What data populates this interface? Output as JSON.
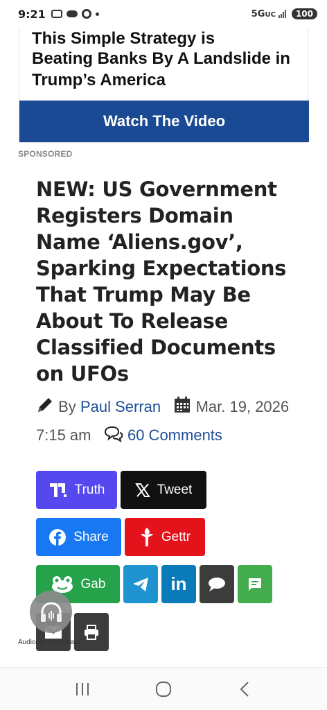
{
  "status_bar": {
    "time": "9:21",
    "network": "5G",
    "network_sub": "UC",
    "battery": "100"
  },
  "ad": {
    "headline_partial": "This Simple Strategy is",
    "headline_rest": "Beating Banks By A Landslide in Trump’s America",
    "button_label": "Watch The Video",
    "sponsored_label": "SPONSORED",
    "button_color": "#1a4a93"
  },
  "article": {
    "title": "NEW: US Government Registers Domain Name ‘Aliens.gov’, Sparking Expectations That Trump May Be About To Release Classified Documents on UFOs",
    "by_label": "By",
    "author": "Paul Serran",
    "date": "Mar. 19, 2026 7:15 am",
    "comments": "60 Comments",
    "link_color": "#1f4f9a"
  },
  "share": {
    "truth": "Truth",
    "tweet": "Tweet",
    "share": "Share",
    "gettr": "Gettr",
    "gab": "Gab",
    "linkedin_glyph": "in",
    "icons": [
      "truth-social-icon",
      "x-icon",
      "facebook-icon",
      "gettr-icon",
      "gab-icon",
      "telegram-icon",
      "linkedin-icon",
      "sms-icon",
      "message-icon",
      "email-icon",
      "print-icon"
    ],
    "colors": {
      "truth": "#5448ee",
      "tweet": "#111111",
      "share": "#1877f2",
      "gettr": "#e3121b",
      "gab": "#25a24a",
      "telegram": "#1f93d0",
      "linkedin": "#0a7bb8",
      "sms": "#3c3c3c",
      "message": "#43ad4e",
      "email": "#3c3c3c",
      "print": "#3c3c3c"
    }
  },
  "audio": {
    "label": "Audio By Carbonatix"
  },
  "nav_bar": {
    "icons": [
      "recent-apps-icon",
      "home-icon",
      "back-icon"
    ]
  }
}
